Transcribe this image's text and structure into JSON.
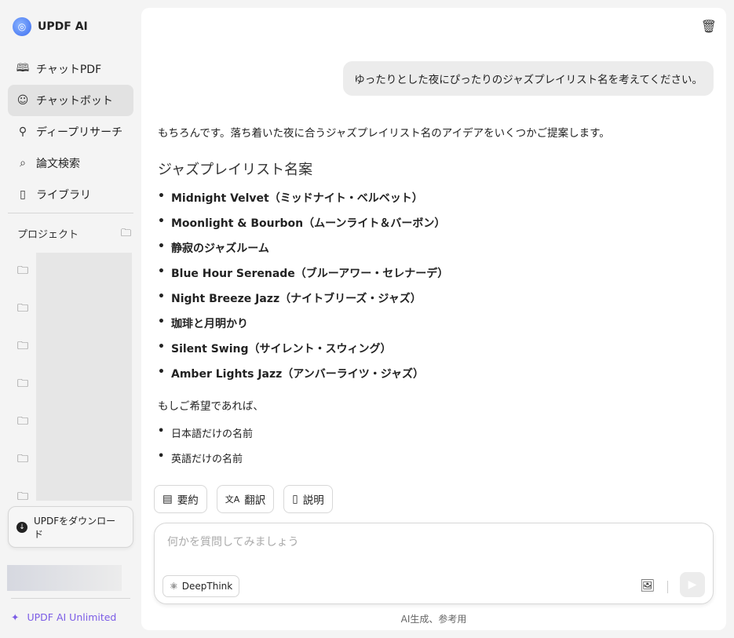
{
  "app": {
    "name": "UPDF AI"
  },
  "sidebar": {
    "items": [
      {
        "label": "チャットPDF",
        "icon": "book-sparkle-icon"
      },
      {
        "label": "チャットボット",
        "icon": "bot-face-icon",
        "active": true
      },
      {
        "label": "ディープリサーチ",
        "icon": "telescope-icon"
      },
      {
        "label": "論文検索",
        "icon": "doc-search-icon"
      },
      {
        "label": "ライブラリ",
        "icon": "library-icon"
      }
    ],
    "projects_label": "プロジェクト",
    "download_label": "UPDFをダウンロード",
    "unlimited_label": "UPDF AI Unlimited"
  },
  "chat": {
    "user_message": "ゆったりとした夜にぴったりのジャズプレイリスト名を考えてください。",
    "intro": "もちろんです。落ち着いた夜に合うジャズプレイリスト名のアイデアをいくつかご提案します。",
    "heading": "ジャズプレイリスト名案",
    "names": [
      "Midnight Velvet（ミッドナイト・ベルベット）",
      "Moonlight & Bourbon（ムーンライト＆バーボン）",
      "静寂のジャズルーム",
      "Blue Hour Serenade（ブルーアワー・セレナーデ）",
      "Night Breeze Jazz（ナイトブリーズ・ジャズ）",
      "珈琲と月明かり",
      "Silent Swing（サイレント・スウィング）",
      "Amber Lights Jazz（アンバーライツ・ジャズ）"
    ],
    "followup": "もしご希望であれば、",
    "options": [
      "日本語だけの名前",
      "英語だけの名前"
    ]
  },
  "actions": [
    {
      "label": "要約"
    },
    {
      "label": "翻訳"
    },
    {
      "label": "説明"
    }
  ],
  "composer": {
    "placeholder": "何かを質問してみましょう",
    "deepthink": "DeepThink"
  },
  "footnote": "AI生成、参考用"
}
